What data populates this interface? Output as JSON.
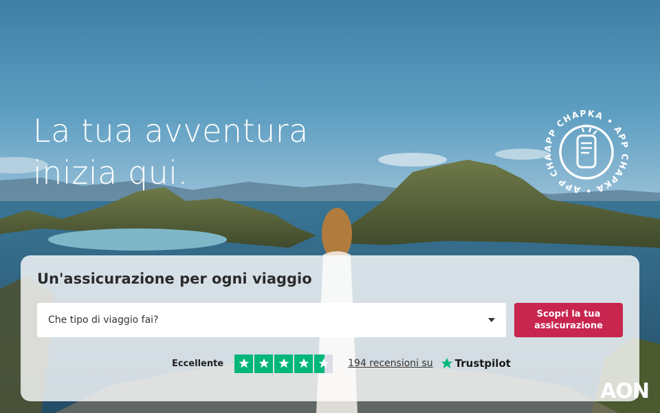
{
  "hero": {
    "headline_line1": "La tua avventura",
    "headline_line2": "inizia qui."
  },
  "badge": {
    "ring_text": "APP CHAPKA • APP CHAPKA • APP CHAPKA •",
    "icon": "phone-icon"
  },
  "search_card": {
    "title": "Un'assicurazione per ogni viaggio",
    "select_placeholder": "Che tipo di viaggio fai?",
    "cta_label": "Scopri la tua assicurazione"
  },
  "trustpilot": {
    "rating_label": "Eccellente",
    "stars": 4.5,
    "reviews_link": "194 recensioni su",
    "brand": "Trustpilot",
    "star_color": "#00b67a"
  },
  "brand": {
    "logo": "AON"
  },
  "colors": {
    "cta": "#c8254f",
    "trustpilot_green": "#00b67a"
  }
}
